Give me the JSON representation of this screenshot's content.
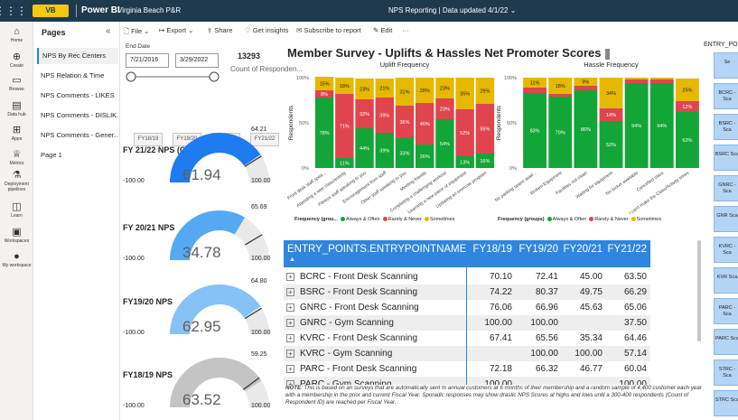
{
  "topbar": {
    "brand": "VB",
    "app": "Power BI",
    "workspace": "Virginia Beach P&R",
    "report_title": "NPS Reporting",
    "data_updated": "Data updated 4/1/22"
  },
  "leftnav": [
    {
      "label": "Home",
      "icon": "home-icon"
    },
    {
      "label": "Create",
      "icon": "plus-icon"
    },
    {
      "label": "Browse",
      "icon": "folder-icon"
    },
    {
      "label": "Data hub",
      "icon": "datahub-icon"
    },
    {
      "label": "Apps",
      "icon": "apps-icon"
    },
    {
      "label": "Metrics",
      "icon": "trophy-icon"
    },
    {
      "label": "Deployment pipelines",
      "icon": "rocket-icon"
    },
    {
      "label": "Learn",
      "icon": "book-icon"
    },
    {
      "label": "Workspaces",
      "icon": "workspaces-icon"
    },
    {
      "label": "My workspace",
      "icon": "avatar-icon"
    }
  ],
  "pages": {
    "header": "Pages",
    "items": [
      "NPS By Rec Centers",
      "NPS Relation & Time",
      "NPS Comments - LIKES",
      "NPS Comments - DISLIK...",
      "NPS Comments - Gener...",
      "Page 1"
    ]
  },
  "toolbar": {
    "file": "File",
    "export": "Export",
    "share": "Share",
    "insights": "Get insights",
    "subscribe": "Subscribe to report",
    "edit": "Edit",
    "more": "···"
  },
  "filters": {
    "end_date_label": "End Date",
    "start": "7/21/2016",
    "end": "3/29/2022",
    "count": "13293",
    "count_label": "Count of Responden...",
    "fy_buttons": [
      "FY18/19",
      "FY19/20",
      "FY20/21",
      "FY21/22"
    ]
  },
  "gauges": [
    {
      "title": "FY 21/22 NPS (Current Year)",
      "value": "61.94",
      "target": "64.21",
      "min": "-100.00",
      "max": "100.00",
      "fraction": 0.81,
      "color": "#1f7bef"
    },
    {
      "title": "FY 20/21 NPS",
      "value": "34.78",
      "target": "65.69",
      "min": "-100.00",
      "max": "100.00",
      "fraction": 0.67,
      "color": "#55a9f3"
    },
    {
      "title": "FY19/20 NPS",
      "value": "62.95",
      "target": "64.80",
      "min": "-100.00",
      "max": "100.00",
      "fraction": 0.81,
      "color": "#86c2f6"
    },
    {
      "title": "FY18/19 NPS",
      "value": "63.52",
      "target": "59.25",
      "min": "-100.00",
      "max": "100.00",
      "fraction": 0.82,
      "color": "#c4c4c4"
    }
  ],
  "main_title": "Member Survey - Uplifts & Hassles Net Promoter Scores",
  "uplift": {
    "title": "Uplift Frequency",
    "ylabel": "Respondents",
    "yticks": [
      "100%",
      "50%",
      "0%"
    ],
    "categories": [
      "Front desk staff spea...",
      "Attending a new class/activity",
      "Fitness staff speaking to you",
      "Encouragement from staff",
      "Other staff speaking to you",
      "Meeting friends",
      "Completing a challenging workout",
      "Learning a new piece of equipment",
      "Updating an exercise program"
    ],
    "green": [
      78,
      11,
      44,
      39,
      33,
      26,
      54,
      13,
      16
    ],
    "red": [
      8,
      71,
      32,
      39,
      36,
      46,
      23,
      52,
      55
    ],
    "yellow": [
      15,
      18,
      23,
      21,
      31,
      28,
      23,
      35,
      29
    ]
  },
  "hassle": {
    "title": "Hassle Frequency",
    "ylabel": "Respondents",
    "yticks": [
      "100%",
      "50%",
      "0%"
    ],
    "categories": [
      "No parking space avail...",
      "Broken Equipment",
      "Facilities not clean",
      "Waiting for equipment",
      "No locker available",
      "Cancelled class",
      "I can't make the Class/Activity times"
    ],
    "green": [
      83,
      79,
      86,
      52,
      94,
      94,
      62
    ],
    "red": [
      6,
      3,
      5,
      14,
      4,
      4,
      12
    ],
    "yellow": [
      11,
      18,
      9,
      34,
      2,
      2,
      25
    ]
  },
  "legend": {
    "label": "Frequency (grou...",
    "label2": "Frequency (groups)",
    "items": [
      "Always & Often",
      "Rarely & Never",
      "Sometimes"
    ],
    "colors": [
      "#13a538",
      "#e0454f",
      "#e6b800"
    ]
  },
  "table": {
    "columns": [
      "ENTRY_POINTS.ENTRYPOINTNAME",
      "FY18/19",
      "FY19/20",
      "FY20/21",
      "FY21/22"
    ],
    "rows": [
      [
        "BCRC - Front Desk Scanning",
        "70.10",
        "72.41",
        "45.00",
        "63.50"
      ],
      [
        "BSRC - Front Desk Scanning",
        "74.22",
        "80.37",
        "49.75",
        "66.29"
      ],
      [
        "GNRC - Front Desk Scanning",
        "76.06",
        "66.96",
        "45.63",
        "65.06"
      ],
      [
        "GNRC - Gym Scanning",
        "100.00",
        "100.00",
        "",
        "37.50"
      ],
      [
        "KVRC - Front Desk Scanning",
        "67.41",
        "65.56",
        "35.34",
        "64.46"
      ],
      [
        "KVRC - Gym Scanning",
        "",
        "100.00",
        "100.00",
        "57.14"
      ],
      [
        "PARC - Front Desk Scanning",
        "72.18",
        "66.32",
        "46.77",
        "60.04"
      ],
      [
        "PARC - Gym Scanning",
        "100.00",
        "",
        "",
        "100.00"
      ]
    ]
  },
  "note": {
    "bold": "NOTE",
    "text": ": This is based on an surveys that are automatically sent to annual customers at 6 months of their membership and a random sample of 4,400 customer each year with a membership in the prior and current Fiscal Year. Sporadic responses may show drastic NPS Scores at highs and lows until a 300-400 respondents (Count of Respondent ID) are reached per Fiscal Year."
  },
  "right": {
    "title": "ENTRY_PO",
    "items": [
      "Se",
      "BCRC - Sca",
      "BSRC - Sca",
      "BSRC Sca",
      "GNRC - Sca",
      "GNR Sca",
      "KVRC - Sca",
      "KVR Sca",
      "PARC - Sca",
      "PARC Sca",
      "STRC - Sca",
      "STRC Sca"
    ]
  }
}
